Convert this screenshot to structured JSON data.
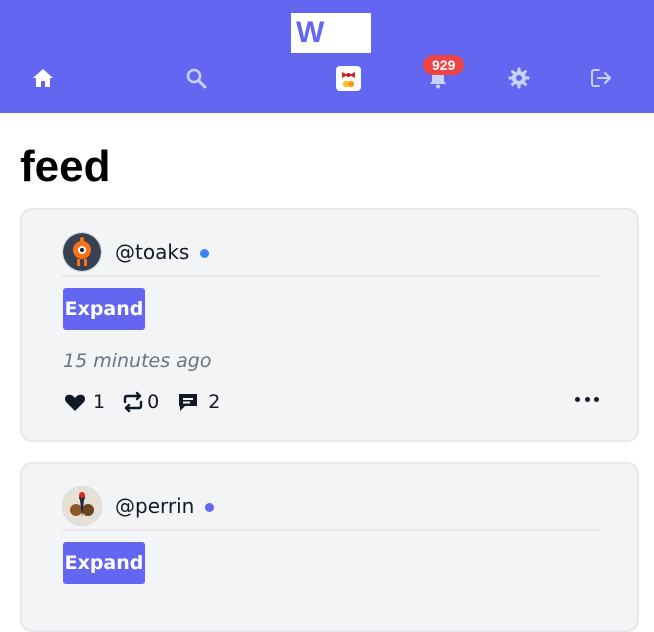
{
  "header": {
    "logo_text": "W",
    "notifications_count": "929",
    "colors": {
      "bar": "#6366f1",
      "badge": "#ef4444"
    },
    "icons": [
      "home-icon",
      "search-icon",
      "user-avatar-icon",
      "bell-icon",
      "gear-icon",
      "logout-icon"
    ]
  },
  "page": {
    "title": "feed"
  },
  "posts": [
    {
      "handle": "@toaks",
      "status_color": "#3b82f6",
      "expand_label": "Expand",
      "timestamp": "15 minutes ago",
      "likes": "1",
      "reposts": "0",
      "comments": "2"
    },
    {
      "handle": "@perrin",
      "status_color": "#6366f1",
      "expand_label": "Expand"
    }
  ]
}
